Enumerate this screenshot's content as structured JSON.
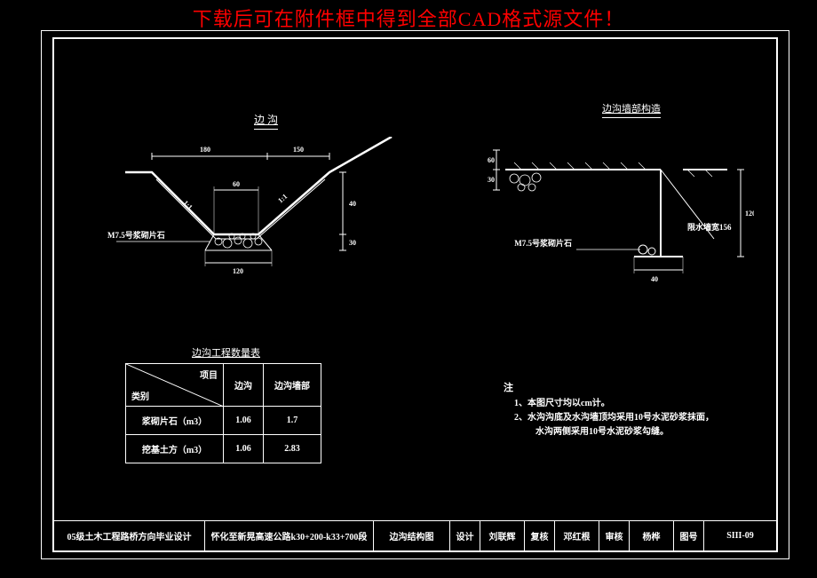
{
  "banner": "下载后可在附件框中得到全部CAD格式源文件！",
  "left_drawing": {
    "title": "边 沟",
    "dims": {
      "top1": "180",
      "top2": "150",
      "mid": "60",
      "bot": "120",
      "h1": "40",
      "h2": "30"
    },
    "slope_left": "1:1",
    "slope_right": "1:1",
    "material": "M7.5号浆砌片石"
  },
  "right_drawing": {
    "title": "边沟墙部构造",
    "dims": {
      "top1": "60",
      "top2": "30",
      "side": "120",
      "bot": "40"
    },
    "material": "M7.5号浆砌片石",
    "note": "限水墙宽156"
  },
  "qty": {
    "title": "边沟工程数量表",
    "diag_top": "项目",
    "diag_bot": "类别",
    "cols": [
      "边沟",
      "边沟墙部"
    ],
    "rows": [
      {
        "label": "浆砌片石（m3）",
        "v": [
          "1.06",
          "1.7"
        ]
      },
      {
        "label": "挖基土方（m3）",
        "v": [
          "1.06",
          "2.83"
        ]
      }
    ]
  },
  "notes": {
    "title": "注",
    "items": [
      "1、本图尺寸均以cm计。",
      "2、水沟沟底及水沟墙顶均采用10号水泥砂浆抹面，",
      "水沟两侧采用10号水泥砂浆勾缝。"
    ]
  },
  "title_block": {
    "c1": "05级土木工程路桥方向毕业设计",
    "c2": "怀化至新晃高速公路k30+200-k33+700段",
    "c3": "边沟结构图",
    "l1": "设计",
    "v1": "刘联辉",
    "l2": "复核",
    "v2": "邓红根",
    "l3": "审核",
    "v3": "杨桦",
    "l4": "图号",
    "v4": "SIII-09"
  }
}
